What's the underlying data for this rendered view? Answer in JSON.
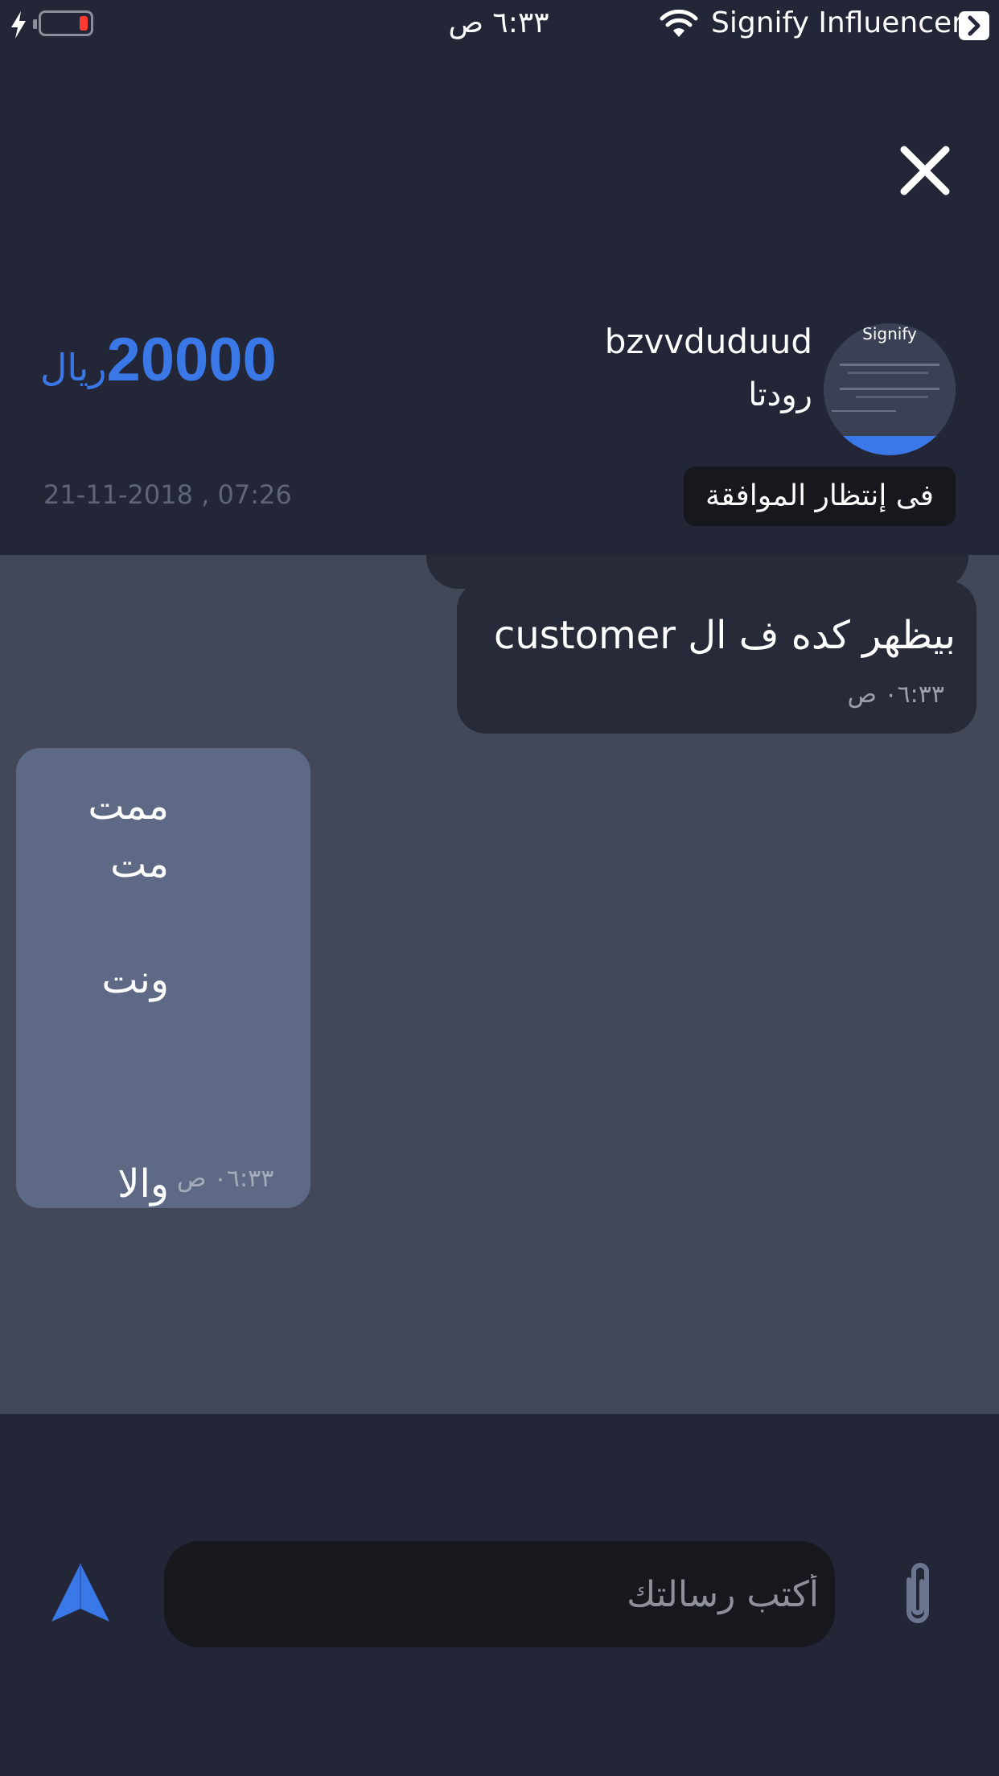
{
  "status_bar": {
    "time": "٦:٣٣ ص",
    "carrier": "Signify Influencer",
    "battery_level": 0.1,
    "icons": [
      "charging-bolt-icon",
      "battery-icon",
      "wifi-icon",
      "back-to-app-icon"
    ]
  },
  "header": {
    "close_icon": "close-icon",
    "user_name": "bzvvduduud",
    "user_subtitle": "رودتا",
    "avatar_text": "Signify",
    "amount_value": "20000",
    "amount_currency": "ريال",
    "status_badge": "فى إنتظار الموافقة",
    "date": "21-11-2018 , 07:26"
  },
  "chat": {
    "messages": [
      {
        "direction": "outgoing",
        "text": "بيظهر كده ف ال customer",
        "time": "٠٦:٣٣ ص"
      },
      {
        "direction": "incoming",
        "lines": [
          "ممت",
          "مت",
          "ونت",
          "والا"
        ],
        "time": "٠٦:٣٣ ص"
      }
    ]
  },
  "composer": {
    "placeholder": "أكتب رسالتك",
    "send_icon": "send-icon",
    "attach_icon": "paperclip-icon"
  },
  "colors": {
    "background": "#222636",
    "chat_background": "#424858",
    "accent": "#3a78e8",
    "outgoing_bubble": "#272a38",
    "incoming_bubble": "#5e6a85"
  }
}
